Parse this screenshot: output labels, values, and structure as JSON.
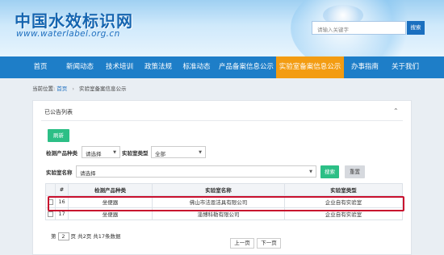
{
  "header": {
    "logo_cn": "中国水效标识网",
    "logo_en": "www.waterlabel.org.cn",
    "search_placeholder": "请输入关键字",
    "search_button": "搜索"
  },
  "nav": [
    "首页",
    "新闻动态",
    "技术培训",
    "政策法规",
    "标准动态",
    "产品备案信息公示",
    "实验室备案信息公示",
    "办事指南",
    "关于我们"
  ],
  "nav_active_index": 6,
  "breadcrumb": {
    "prefix": "当前位置",
    "home": "首页",
    "current": "实验室备案信息公示"
  },
  "panel": {
    "title": "已公告列表",
    "toggle": "⌃"
  },
  "filters": {
    "refresh": "刷新",
    "product_label": "检测产品种类",
    "product_value": "请选择",
    "lab_type_label": "实验室类型",
    "lab_type_value": "全部",
    "lab_name_label": "实验室名称",
    "lab_name_value": "请选择",
    "search": "搜索",
    "reset": "重置"
  },
  "table": {
    "headers": [
      "",
      "#",
      "检测产品种类",
      "实验室名称",
      "实验室类型"
    ],
    "rows": [
      {
        "num": "16",
        "product": "坐便器",
        "name": "佛山市法恩洁具有限公司",
        "type": "企业自有实验室"
      },
      {
        "num": "17",
        "product": "坐便器",
        "name": "淄博科勒有限公司",
        "type": "企业自有实验室"
      }
    ]
  },
  "pager": {
    "page_prefix": "第",
    "page_value": "2",
    "summary": "页 共2页 共17条数据",
    "prev": "上一页",
    "next": "下一页"
  },
  "colors": {
    "nav": "#1e7ec8",
    "nav_active": "#f39c12",
    "button_green": "#2cbf86",
    "highlight": "#c8102e"
  }
}
